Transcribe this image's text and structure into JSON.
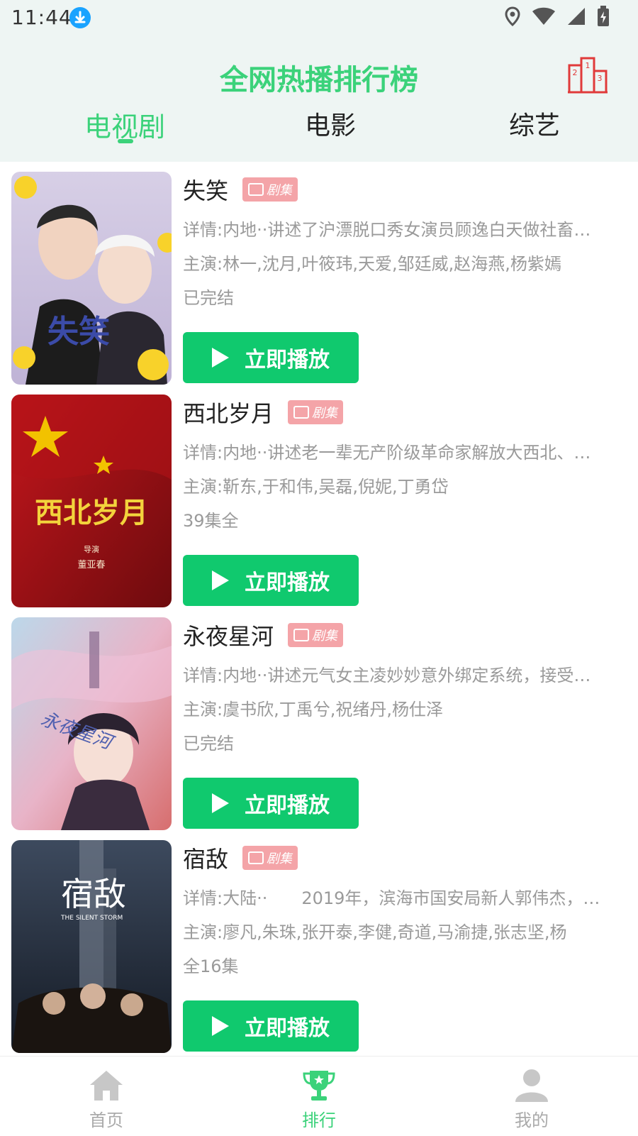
{
  "status_bar": {
    "time": "11:44",
    "icons": [
      "download-icon",
      "location-icon",
      "wifi-icon",
      "signal-icon",
      "battery-charging-icon"
    ]
  },
  "header": {
    "title": "全网热播排行榜",
    "rank_icon": "podium-icon"
  },
  "tabs": [
    {
      "label": "电视剧",
      "active": true
    },
    {
      "label": "电影",
      "active": false
    },
    {
      "label": "综艺",
      "active": false
    }
  ],
  "items": [
    {
      "title": "失笑",
      "badge": "剧集",
      "desc": "详情:内地··讲述了沪漂脱口秀女演员顾逸白天做社畜…",
      "cast": "主演:林一,沈月,叶筱玮,天爱,邹廷威,赵海燕,杨紫嫣",
      "status": "已完结",
      "poster_text": "失笑",
      "button": "立即播放"
    },
    {
      "title": "西北岁月",
      "badge": "剧集",
      "desc": "详情:内地··讲述老一辈无产阶级革命家解放大西北、…",
      "cast": "主演:靳东,于和伟,吴磊,倪妮,丁勇岱",
      "status": "39集全",
      "poster_text": "西北岁月",
      "poster_sub": "导演",
      "poster_name": "董亚春",
      "button": "立即播放"
    },
    {
      "title": "永夜星河",
      "badge": "剧集",
      "desc": "详情:内地··讲述元气女主凌妙妙意外绑定系统，接受…",
      "cast": "主演:虞书欣,丁禹兮,祝绪丹,杨仕泽",
      "status": "已完结",
      "poster_text": "永夜星河",
      "button": "立即播放"
    },
    {
      "title": "宿敌",
      "badge": "剧集",
      "desc": "详情:大陆··　　2019年，滨海市国安局新人郭伟杰，…",
      "cast": "主演:廖凡,朱珠,张开泰,李健,奇道,马渝捷,张志坚,杨",
      "status": "全16集",
      "poster_text": "宿敌",
      "poster_sub": "THE SILENT STORM",
      "button": "立即播放"
    }
  ],
  "bottom_nav": [
    {
      "label": "首页",
      "icon": "home-icon",
      "active": false
    },
    {
      "label": "排行",
      "icon": "trophy-icon",
      "active": true
    },
    {
      "label": "我的",
      "icon": "user-icon",
      "active": false
    }
  ],
  "colors": {
    "accent": "#3bd27a",
    "button": "#10c96e",
    "badge": "#f4a4a8",
    "podium": "#e03a3a"
  }
}
